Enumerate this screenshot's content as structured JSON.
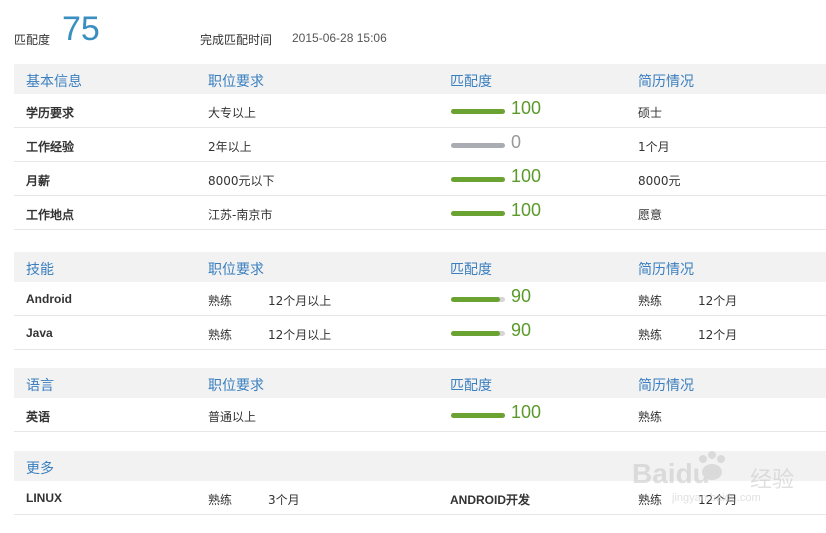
{
  "header": {
    "match_label": "匹配度",
    "match_score": "75",
    "time_label": "完成匹配时间",
    "time_value": "2015-06-28 15:06"
  },
  "colors": {
    "accent": "#3a8fc1",
    "score_green": "#5a9a2a",
    "bar_green": "#6aa332",
    "header_bg": "#f2f2f2"
  },
  "basic": {
    "headers": [
      "基本信息",
      "职位要求",
      "匹配度",
      "简历情况"
    ],
    "rows": [
      {
        "name": "学历要求",
        "req": "大专以上",
        "score": "100",
        "fill": 1.0,
        "resume": "硕士"
      },
      {
        "name": "工作经验",
        "req": "2年以上",
        "score": "0",
        "fill": 0.0,
        "resume": "1个月"
      },
      {
        "name": "月薪",
        "req": "8000元以下",
        "score": "100",
        "fill": 1.0,
        "resume": "8000元"
      },
      {
        "name": "工作地点",
        "req": "江苏-南京市",
        "score": "100",
        "fill": 1.0,
        "resume": "愿意"
      }
    ]
  },
  "skills": {
    "headers": [
      "技能",
      "职位要求",
      "匹配度",
      "简历情况"
    ],
    "rows": [
      {
        "name": "Android",
        "level": "熟练",
        "duration": "12个月以上",
        "score": "90",
        "fill": 0.9,
        "resume_level": "熟练",
        "resume_duration": "12个月"
      },
      {
        "name": "Java",
        "level": "熟练",
        "duration": "12个月以上",
        "score": "90",
        "fill": 0.9,
        "resume_level": "熟练",
        "resume_duration": "12个月"
      }
    ]
  },
  "languages": {
    "headers": [
      "语言",
      "职位要求",
      "匹配度",
      "简历情况"
    ],
    "rows": [
      {
        "name": "英语",
        "req": "普通以上",
        "score": "100",
        "fill": 1.0,
        "resume": "熟练"
      }
    ]
  },
  "more": {
    "header": "更多",
    "rows": [
      {
        "name": "LINUX",
        "level": "熟练",
        "duration": "3个月",
        "name2": "ANDROID开发",
        "level2": "熟练",
        "duration2": "12个月"
      }
    ]
  },
  "watermark": {
    "brand": "Baidu",
    "cn": "经验",
    "url": "jingyan.baidu.com"
  }
}
